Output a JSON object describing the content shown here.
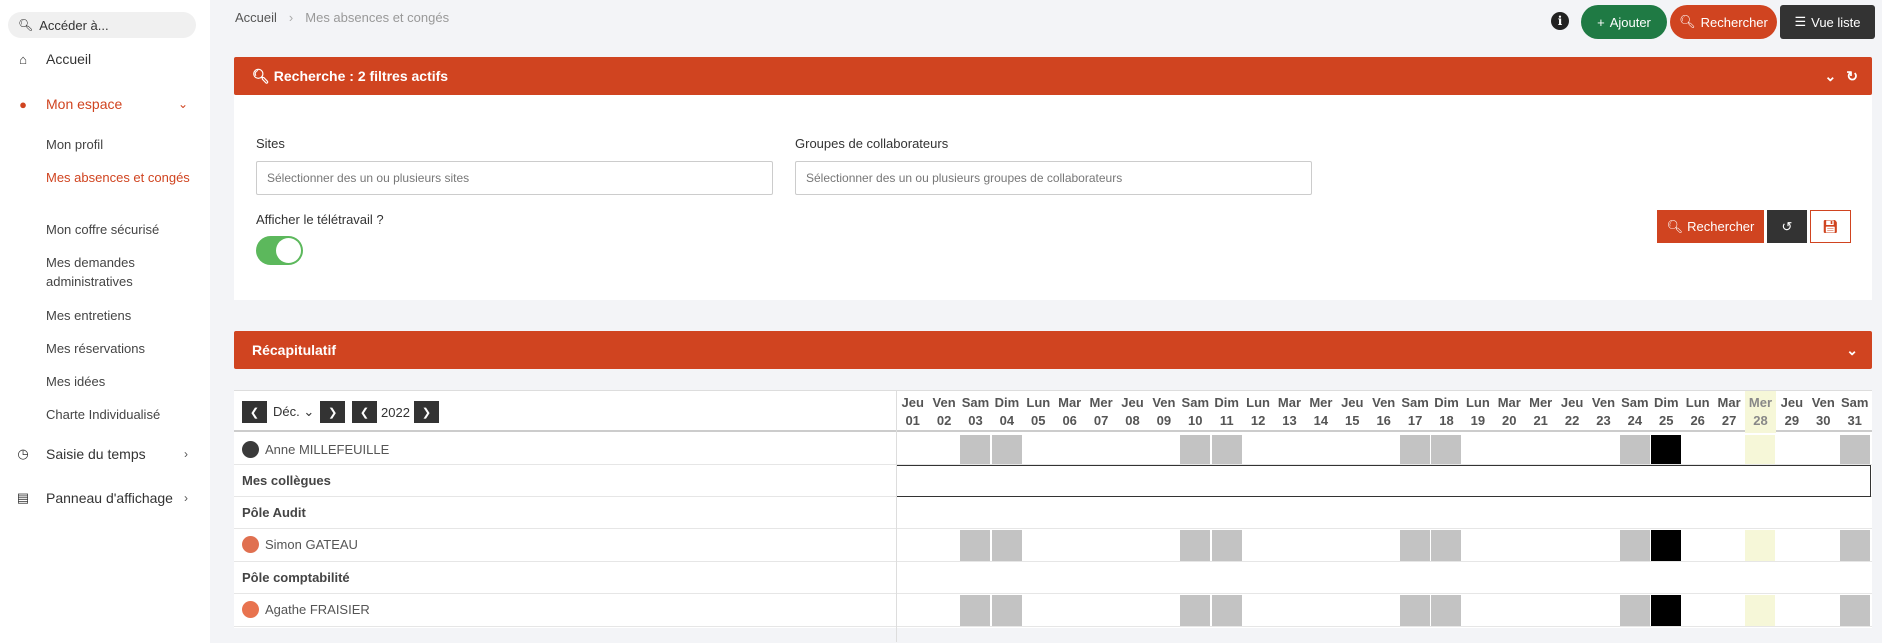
{
  "sidebar": {
    "search_placeholder": "Accéder à...",
    "items": [
      {
        "label": "Accueil",
        "icon": "home-icon"
      },
      {
        "label": "Mon espace",
        "icon": "user-icon"
      },
      {
        "label": "Saisie du temps",
        "icon": "clock-icon"
      },
      {
        "label": "Panneau d'affichage",
        "icon": "display-icon"
      }
    ],
    "sub_items": [
      {
        "label": "Mon profil"
      },
      {
        "label": "Mes absences et congés"
      },
      {
        "label": "Mon coffre sécurisé"
      },
      {
        "label": "Mes demandes administratives"
      },
      {
        "label": "Mes entretiens"
      },
      {
        "label": "Mes réservations"
      },
      {
        "label": "Mes idées"
      },
      {
        "label": "Charte Individualisé"
      }
    ]
  },
  "breadcrumb": {
    "home": "Accueil",
    "current": "Mes absences et congés"
  },
  "toolbar": {
    "add_label": "Ajouter",
    "search_label": "Rechercher",
    "list_label": "Vue liste"
  },
  "search_panel": {
    "title": "Recherche : 2 filtres actifs",
    "sites_label": "Sites",
    "sites_placeholder": "Sélectionner des un ou plusieurs sites",
    "groups_label": "Groupes de collaborateurs",
    "groups_placeholder": "Sélectionner des un ou plusieurs groupes de collaborateurs",
    "telework_label": "Afficher le télétravail ?",
    "telework_on": true,
    "search_button": "Rechercher"
  },
  "summary_panel": {
    "title": "Récapitulatif"
  },
  "calendar": {
    "month": "Déc.",
    "year": "2022",
    "highlight_day": 28,
    "days": [
      {
        "dow": "Jeu",
        "num": "01"
      },
      {
        "dow": "Ven",
        "num": "02"
      },
      {
        "dow": "Sam",
        "num": "03"
      },
      {
        "dow": "Dim",
        "num": "04"
      },
      {
        "dow": "Lun",
        "num": "05"
      },
      {
        "dow": "Mar",
        "num": "06"
      },
      {
        "dow": "Mer",
        "num": "07"
      },
      {
        "dow": "Jeu",
        "num": "08"
      },
      {
        "dow": "Ven",
        "num": "09"
      },
      {
        "dow": "Sam",
        "num": "10"
      },
      {
        "dow": "Dim",
        "num": "11"
      },
      {
        "dow": "Lun",
        "num": "12"
      },
      {
        "dow": "Mar",
        "num": "13"
      },
      {
        "dow": "Mer",
        "num": "14"
      },
      {
        "dow": "Jeu",
        "num": "15"
      },
      {
        "dow": "Ven",
        "num": "16"
      },
      {
        "dow": "Sam",
        "num": "17"
      },
      {
        "dow": "Dim",
        "num": "18"
      },
      {
        "dow": "Lun",
        "num": "19"
      },
      {
        "dow": "Mar",
        "num": "20"
      },
      {
        "dow": "Mer",
        "num": "21"
      },
      {
        "dow": "Jeu",
        "num": "22"
      },
      {
        "dow": "Ven",
        "num": "23"
      },
      {
        "dow": "Sam",
        "num": "24"
      },
      {
        "dow": "Dim",
        "num": "25"
      },
      {
        "dow": "Lun",
        "num": "26"
      },
      {
        "dow": "Mar",
        "num": "27"
      },
      {
        "dow": "Mer",
        "num": "28"
      },
      {
        "dow": "Jeu",
        "num": "29"
      },
      {
        "dow": "Ven",
        "num": "30"
      },
      {
        "dow": "Sam",
        "num": "31"
      }
    ],
    "weekend_days": [
      3,
      4,
      10,
      11,
      17,
      18,
      24,
      31
    ],
    "holiday_days": [
      25
    ],
    "rows": [
      {
        "type": "person",
        "name": "Anne MILLEFEUILLE",
        "avatar_color": "#3a3a3a"
      },
      {
        "type": "group",
        "name": "Mes collègues"
      },
      {
        "type": "group",
        "name": "Pôle Audit"
      },
      {
        "type": "person",
        "name": "Simon GATEAU",
        "avatar_color": "#e07050"
      },
      {
        "type": "group",
        "name": "Pôle comptabilité"
      },
      {
        "type": "person",
        "name": "Agathe FRAISIER",
        "avatar_color": "#e8734f"
      }
    ]
  },
  "colors": {
    "accent": "#d04420",
    "success": "#1f7a44",
    "dark": "#333333",
    "weekend": "#c3c3c3",
    "today": "#f6f7d8"
  }
}
